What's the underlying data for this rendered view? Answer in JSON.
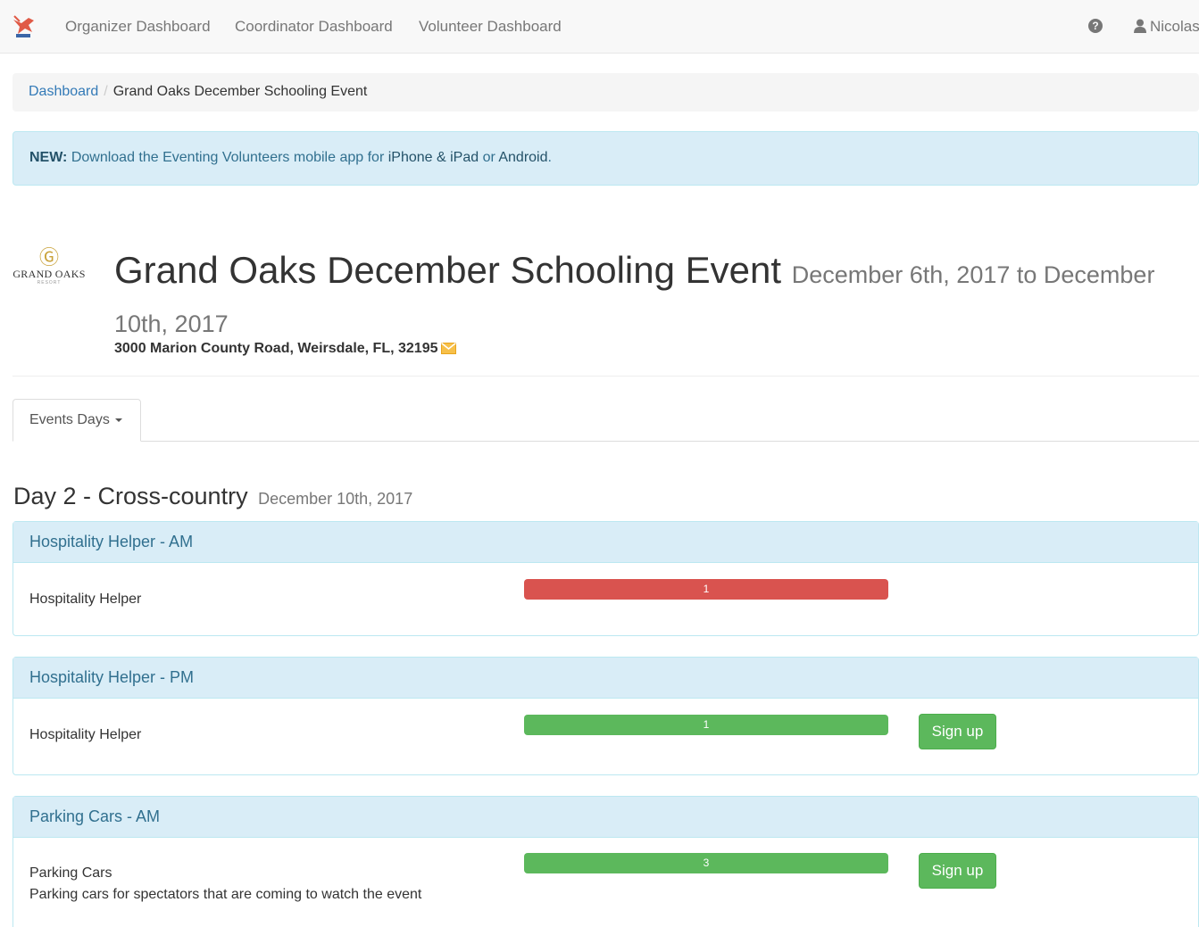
{
  "navbar": {
    "links": [
      "Organizer Dashboard",
      "Coordinator Dashboard",
      "Volunteer Dashboard"
    ],
    "user_name": "Nicolas"
  },
  "breadcrumb": {
    "home": "Dashboard",
    "current": "Grand Oaks December Schooling Event"
  },
  "alert": {
    "prefix": "NEW:",
    "text_1": " Download the Eventing Volunteers mobile app for ",
    "link_ios": "iPhone & iPad",
    "text_2": " or ",
    "link_android": "Android",
    "text_3": "."
  },
  "event": {
    "logo_text": "GRAND OAKS",
    "logo_sub": "RESORT",
    "title": "Grand Oaks December Schooling Event",
    "dates": "December 6th, 2017 to December 10th, 2017",
    "address": "3000 Marion County Road, Weirsdale, FL, 32195"
  },
  "tabs": {
    "events_days": "Events Days"
  },
  "day": {
    "title": "Day 2 - Cross-country",
    "date": "December 10th, 2017"
  },
  "panels": [
    {
      "heading": "Hospitality Helper - AM",
      "job": "Hospitality Helper",
      "description": "",
      "count": "1",
      "bar_status": "full",
      "bar_fill": 1.0,
      "signup_label": ""
    },
    {
      "heading": "Hospitality Helper - PM",
      "job": "Hospitality Helper",
      "description": "",
      "count": "1",
      "bar_status": "open",
      "bar_fill": 1.0,
      "signup_label": "Sign up"
    },
    {
      "heading": "Parking Cars - AM",
      "job": "Parking Cars",
      "description": "Parking cars for spectators that are coming to watch the event",
      "count": "3",
      "bar_status": "open",
      "bar_fill": 1.0,
      "signup_label": "Sign up"
    }
  ],
  "colors": {
    "bar_full": "#d9534f",
    "bar_open": "#5cb85c",
    "info_bg": "#d9edf7",
    "info_text": "#31708f",
    "link": "#337ab7"
  }
}
